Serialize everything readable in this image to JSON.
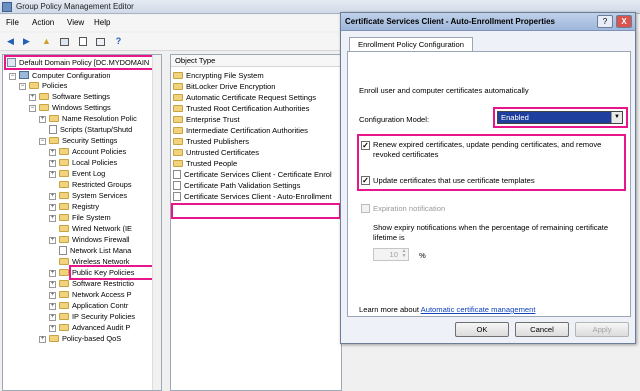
{
  "app": {
    "title": "Group Policy Management Editor",
    "menu": [
      "File",
      "Action",
      "View",
      "Help"
    ]
  },
  "toolbar": {
    "icons": [
      "back-arrow-icon",
      "forward-arrow-icon",
      "up-folder-icon",
      "show-hide-tree-icon",
      "properties-icon",
      "export-list-icon",
      "help-icon"
    ]
  },
  "tree": {
    "root": {
      "label": "Default Domain Policy",
      "suffix": "[DC.MYDOMAIN"
    },
    "computer_configuration": "Computer Configuration",
    "policies": "Policies",
    "software_settings": "Software Settings",
    "windows_settings": "Windows Settings",
    "name_resolution_policy": "Name Resolution Polic",
    "scripts": "Scripts (Startup/Shutd",
    "security_settings": "Security Settings",
    "account_policies": "Account Policies",
    "local_policies": "Local Policies",
    "event_log": "Event Log",
    "restricted_groups": "Restricted Groups",
    "system_services": "System Services",
    "registry": "Registry",
    "file_system": "File System",
    "wired_network": "Wired Network (IE",
    "windows_firewall": "Windows Firewall",
    "network_list_manager": "Network List Mana",
    "wireless_network": "Wireless Network",
    "public_key_policies": "Public Key Policies",
    "software_restriction": "Software Restrictio",
    "network_access_protection": "Network Access P",
    "application_control": "Application Contr",
    "ip_security_policies": "IP Security Policies",
    "advanced_audit": "Advanced Audit P",
    "policy_based_qos": "Policy-based QoS"
  },
  "list": {
    "column_header": "Object Type",
    "items": [
      "Encrypting File System",
      "BitLocker Drive Encryption",
      "Automatic Certificate Request Settings",
      "Trusted Root Certification Authorities",
      "Enterprise Trust",
      "Intermediate Certification Authorities",
      "Trusted Publishers",
      "Untrusted Certificates",
      "Trusted People",
      "Certificate Services Client - Certificate Enrol",
      "Certificate Path Validation Settings",
      "Certificate Services Client - Auto-Enrollment"
    ]
  },
  "dialog": {
    "title": "Certificate Services Client - Auto-Enrollment Properties",
    "help_label": "?",
    "close_label": "X",
    "tab_label": "Enrollment Policy Configuration",
    "intro": "Enroll user and computer certificates automatically",
    "config_model_label": "Configuration Model:",
    "config_model_value": "Enabled",
    "renew_label_1": "Renew expired certificates, update pending certificates, and remove",
    "renew_label_2": "revoked certificates",
    "renew_checked": true,
    "update_label": "Update certificates that use certificate templates",
    "update_checked": true,
    "expiration_label": "Expiration notification",
    "expiry_text_1": "Show expiry notifications when the percentage of remaining certificate",
    "expiry_text_2": "lifetime is",
    "expiry_value": "10",
    "percent_sign": "%",
    "learn_more_prefix": "Learn more about",
    "learn_more_link": "Automatic certificate management",
    "ok_label": "OK",
    "cancel_label": "Cancel",
    "apply_label": "Apply"
  },
  "colors": {
    "highlight": "#e8168a",
    "selected_select_bg": "#1f3f9e",
    "link": "#1144bb"
  }
}
